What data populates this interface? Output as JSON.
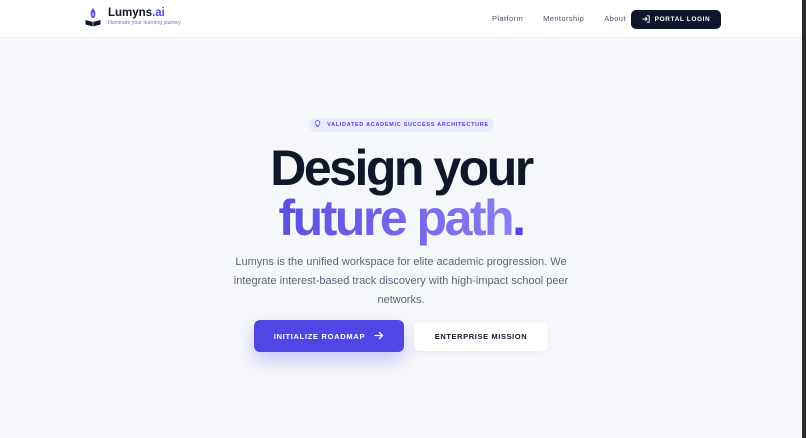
{
  "brand": {
    "name_primary": "Lumyns",
    "name_accent": ".ai",
    "tagline": "Illuminate your learning journey",
    "logo_icon": "flame-book-icon"
  },
  "nav": {
    "links": [
      {
        "label": "Platform"
      },
      {
        "label": "Mentorship"
      },
      {
        "label": "About"
      }
    ],
    "portal_button": {
      "label": "PORTAL LOGIN",
      "icon": "login-arrow-icon"
    }
  },
  "hero": {
    "badge": {
      "label": "VALIDATED ACADEMIC SUCCESS ARCHITECTURE",
      "icon": "lightbulb-icon"
    },
    "headline_line1": "Design your",
    "headline_line2": "future path",
    "headline_dot": ".",
    "description": "Lumyns is the unified workspace for elite academic progression. We integrate interest-based track discovery with high-impact school peer networks.",
    "primary_cta": {
      "label": "INITIALIZE ROADMAP",
      "icon": "arrow-right-icon"
    },
    "secondary_cta": {
      "label": "ENTERPRISE MISSION"
    }
  },
  "colors": {
    "accent": "#4f46e5",
    "dark": "#0f172a",
    "background": "#f6f7fa",
    "headline_gradient_start": "#5b4fe0",
    "headline_gradient_end": "#8b7cf0"
  }
}
